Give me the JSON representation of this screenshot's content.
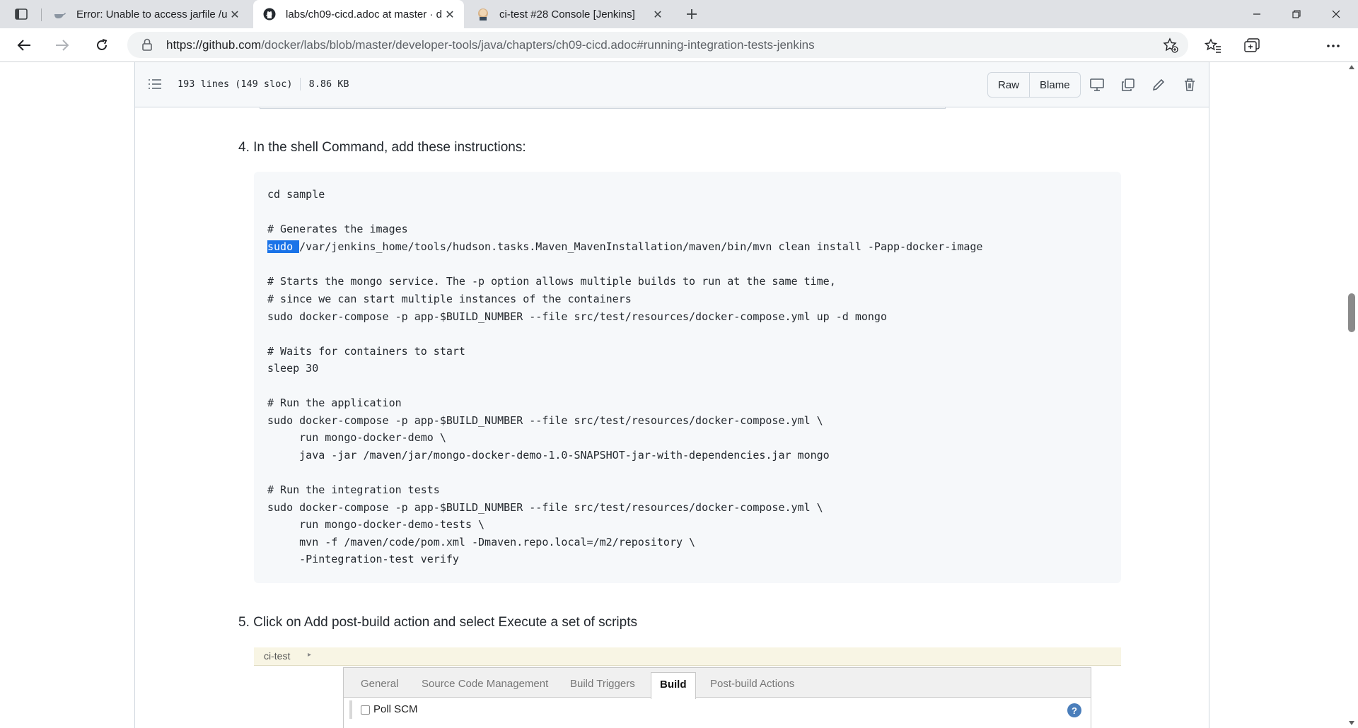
{
  "browser": {
    "tabs": [
      {
        "title": "Error: Unable to access jarfile /us",
        "icon": "docker-icon",
        "active": false
      },
      {
        "title": "labs/ch09-cicd.adoc at master · d",
        "icon": "github-icon",
        "active": true
      },
      {
        "title": "ci-test #28 Console [Jenkins]",
        "icon": "jenkins-icon",
        "active": false
      }
    ],
    "url_host": "https://github.com",
    "url_path": "/docker/labs/blob/master/developer-tools/java/chapters/ch09-cicd.adoc#running-integration-tests-jenkins"
  },
  "file_header": {
    "lines": "193 lines (149 sloc)",
    "size": "8.86 KB",
    "raw_label": "Raw",
    "blame_label": "Blame"
  },
  "content": {
    "step4": "4. In the shell Command, add these instructions:",
    "step5": "5. Click on Add post-build action and select Execute a set of scripts",
    "code": {
      "l01": "cd sample",
      "l03": "# Generates the images",
      "l04_sel": "sudo ",
      "l04_rest": "/var/jenkins_home/tools/hudson.tasks.Maven_MavenInstallation/maven/bin/mvn clean install -Papp-docker-image",
      "l06": "# Starts the mongo service. The -p option allows multiple builds to run at the same time,",
      "l07": "# since we can start multiple instances of the containers",
      "l08": "sudo docker-compose -p app-$BUILD_NUMBER --file src/test/resources/docker-compose.yml up -d mongo",
      "l10": "# Waits for containers to start",
      "l11": "sleep 30",
      "l13": "# Run the application",
      "l14": "sudo docker-compose -p app-$BUILD_NUMBER --file src/test/resources/docker-compose.yml \\",
      "l15": "     run mongo-docker-demo \\",
      "l16": "     java -jar /maven/jar/mongo-docker-demo-1.0-SNAPSHOT-jar-with-dependencies.jar mongo",
      "l18": "# Run the integration tests",
      "l19": "sudo docker-compose -p app-$BUILD_NUMBER --file src/test/resources/docker-compose.yml \\",
      "l20": "     run mongo-docker-demo-tests \\",
      "l21": "     mvn -f /maven/code/pom.xml -Dmaven.repo.local=/m2/repository \\",
      "l22": "     -Pintegration-test verify"
    }
  },
  "jenkins": {
    "breadcrumb": "ci-test",
    "tabs": [
      "General",
      "Source Code Management",
      "Build Triggers",
      "Build",
      "Post-build Actions"
    ],
    "active_tab": "Build",
    "poll_scm": "Poll SCM",
    "help": "?"
  },
  "colors": {
    "selection": "#1a73e8",
    "code_bg": "#f6f8fa",
    "help_blue": "#4a7ebb"
  }
}
